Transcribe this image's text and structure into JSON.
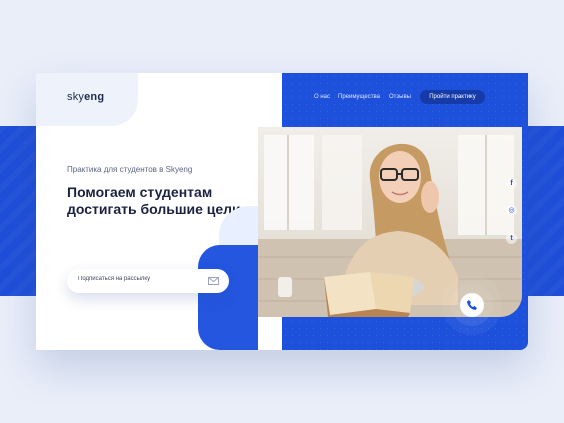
{
  "brand": {
    "logo_prefix": "sky",
    "logo_suffix": "eng"
  },
  "nav": {
    "items": [
      {
        "label": "О нас"
      },
      {
        "label": "Преимущества"
      },
      {
        "label": "Отзывы"
      }
    ],
    "cta_label": "Пройти практику"
  },
  "hero": {
    "subtitle": "Практика для студентов в Skyeng",
    "headline": "Помогаем студентам достигать большие цели"
  },
  "newsletter": {
    "placeholder": "Подписаться на рассылку",
    "icon": "mail-icon"
  },
  "social": [
    {
      "icon": "facebook-icon",
      "glyph": "f"
    },
    {
      "icon": "instagram-icon",
      "glyph": "◎"
    },
    {
      "icon": "twitter-icon",
      "glyph": "t"
    }
  ],
  "call_button": {
    "icon": "phone-icon"
  },
  "colors": {
    "accent": "#1d50db",
    "dark_text": "#1a2240",
    "stripe": "#1f4fd8"
  }
}
